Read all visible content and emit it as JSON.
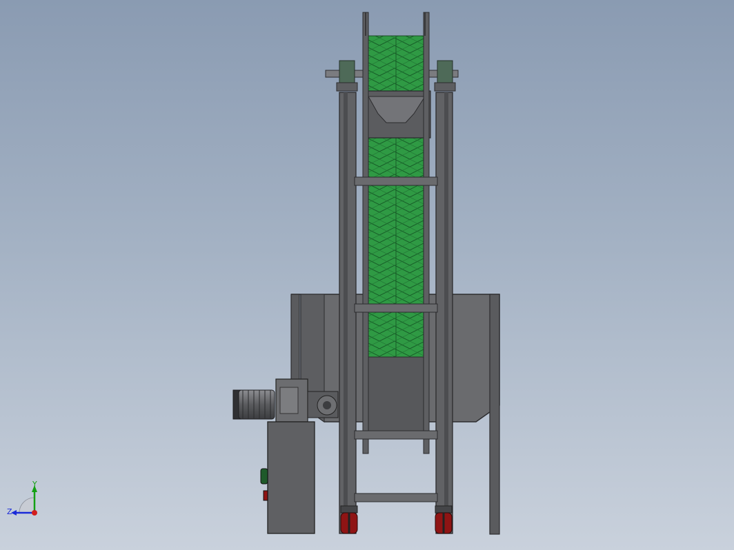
{
  "triad": {
    "y_label": "Y",
    "z_label": "Z",
    "y_color": "#14a014",
    "z_color": "#1a2ad8",
    "x_color": "#d21e1e"
  },
  "colors": {
    "background_top": "#8a9bb2",
    "background_bottom": "#c9d1dc",
    "frame": "#5e5f62",
    "frame_edge": "#2b2b2d",
    "belt_mesh": "#2f9a44",
    "hopper": "#68696c",
    "wheel": "#9a1212",
    "motor": "#6e6f72"
  }
}
